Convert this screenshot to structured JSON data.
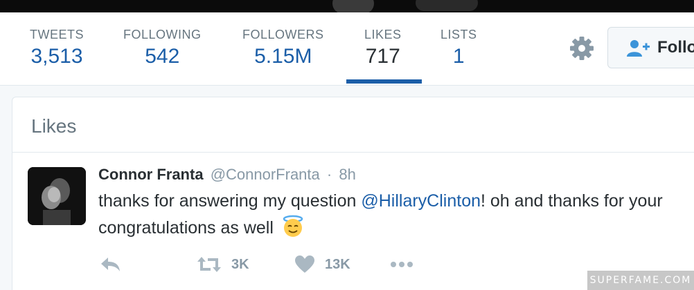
{
  "profile_nav": {
    "stats": [
      {
        "label": "TWEETS",
        "value": "3,513"
      },
      {
        "label": "FOLLOWING",
        "value": "542"
      },
      {
        "label": "FOLLOWERS",
        "value": "5.15M"
      },
      {
        "label": "LIKES",
        "value": "717"
      },
      {
        "label": "LISTS",
        "value": "1"
      }
    ],
    "active_tab": "LIKES",
    "follow_button_label": "Follo",
    "settings_icon": "gear-icon",
    "follow_icon": "add-user-icon"
  },
  "likes_section": {
    "title": "Likes"
  },
  "tweet": {
    "author_name": "Connor Franta",
    "handle": "@ConnorFranta",
    "separator": "·",
    "time": "8h",
    "text_before": "thanks for answering my question ",
    "mention": "@HillaryClinton",
    "text_after": "! oh and thanks for your congratulations as well",
    "emoji": "smiling-face-with-halo",
    "actions": {
      "reply_icon": "reply-icon",
      "retweet_icon": "retweet-icon",
      "retweet_count": "3K",
      "like_icon": "heart-icon",
      "like_count": "13K",
      "more_icon": "more-icon"
    }
  },
  "watermark": "SUPERFAME.COM",
  "colors": {
    "link_blue": "#1b5ea8",
    "muted_gray": "#8899a6",
    "text_dark": "#292f33",
    "active_underline": "#1b5ea8"
  }
}
